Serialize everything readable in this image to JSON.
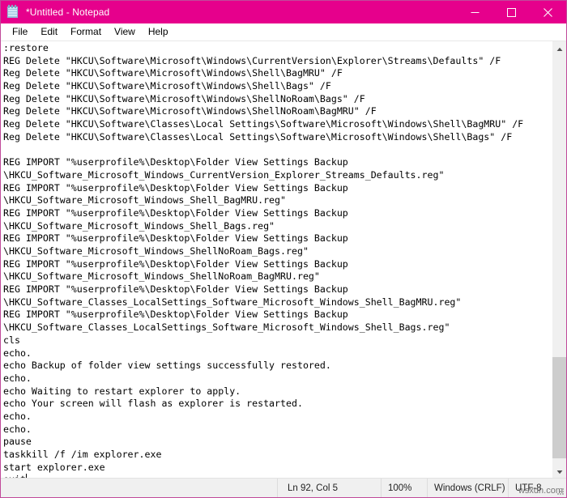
{
  "window": {
    "title": "*Untitled - Notepad",
    "icon": "notepad-icon",
    "accent_color": "#e6008c",
    "controls": {
      "minimize": "Minimize",
      "maximize": "Maximize",
      "close": "Close"
    }
  },
  "menubar": {
    "items": [
      {
        "label": "File"
      },
      {
        "label": "Edit"
      },
      {
        "label": "Format"
      },
      {
        "label": "View"
      },
      {
        "label": "Help"
      }
    ]
  },
  "editor": {
    "lines": [
      ":restore",
      "REG Delete \"HKCU\\Software\\Microsoft\\Windows\\CurrentVersion\\Explorer\\Streams\\Defaults\" /F",
      "Reg Delete \"HKCU\\Software\\Microsoft\\Windows\\Shell\\BagMRU\" /F",
      "Reg Delete \"HKCU\\Software\\Microsoft\\Windows\\Shell\\Bags\" /F",
      "Reg Delete \"HKCU\\Software\\Microsoft\\Windows\\ShellNoRoam\\Bags\" /F",
      "Reg Delete \"HKCU\\Software\\Microsoft\\Windows\\ShellNoRoam\\BagMRU\" /F",
      "Reg Delete \"HKCU\\Software\\Classes\\Local Settings\\Software\\Microsoft\\Windows\\Shell\\BagMRU\" /F",
      "Reg Delete \"HKCU\\Software\\Classes\\Local Settings\\Software\\Microsoft\\Windows\\Shell\\Bags\" /F",
      "",
      "REG IMPORT \"%userprofile%\\Desktop\\Folder View Settings Backup",
      "\\HKCU_Software_Microsoft_Windows_CurrentVersion_Explorer_Streams_Defaults.reg\"",
      "REG IMPORT \"%userprofile%\\Desktop\\Folder View Settings Backup",
      "\\HKCU_Software_Microsoft_Windows_Shell_BagMRU.reg\"",
      "REG IMPORT \"%userprofile%\\Desktop\\Folder View Settings Backup",
      "\\HKCU_Software_Microsoft_Windows_Shell_Bags.reg\"",
      "REG IMPORT \"%userprofile%\\Desktop\\Folder View Settings Backup",
      "\\HKCU_Software_Microsoft_Windows_ShellNoRoam_Bags.reg\"",
      "REG IMPORT \"%userprofile%\\Desktop\\Folder View Settings Backup",
      "\\HKCU_Software_Microsoft_Windows_ShellNoRoam_BagMRU.reg\"",
      "REG IMPORT \"%userprofile%\\Desktop\\Folder View Settings Backup",
      "\\HKCU_Software_Classes_LocalSettings_Software_Microsoft_Windows_Shell_BagMRU.reg\"",
      "REG IMPORT \"%userprofile%\\Desktop\\Folder View Settings Backup",
      "\\HKCU_Software_Classes_LocalSettings_Software_Microsoft_Windows_Shell_Bags.reg\"",
      "cls",
      "echo.",
      "echo Backup of folder view settings successfully restored.",
      "echo.",
      "echo Waiting to restart explorer to apply.",
      "echo Your screen will flash as explorer is restarted.",
      "echo.",
      "echo.",
      "pause",
      "taskkill /f /im explorer.exe",
      "start explorer.exe",
      "exit"
    ],
    "caret_line_index": 35
  },
  "scrollbar": {
    "up_arrow": "chevron-up-icon",
    "down_arrow": "chevron-down-icon"
  },
  "statusbar": {
    "position": "Ln 92, Col 5",
    "zoom": "100%",
    "line_ending": "Windows (CRLF)",
    "encoding": "UTF-8",
    "watermark": "wsxdn.com"
  }
}
